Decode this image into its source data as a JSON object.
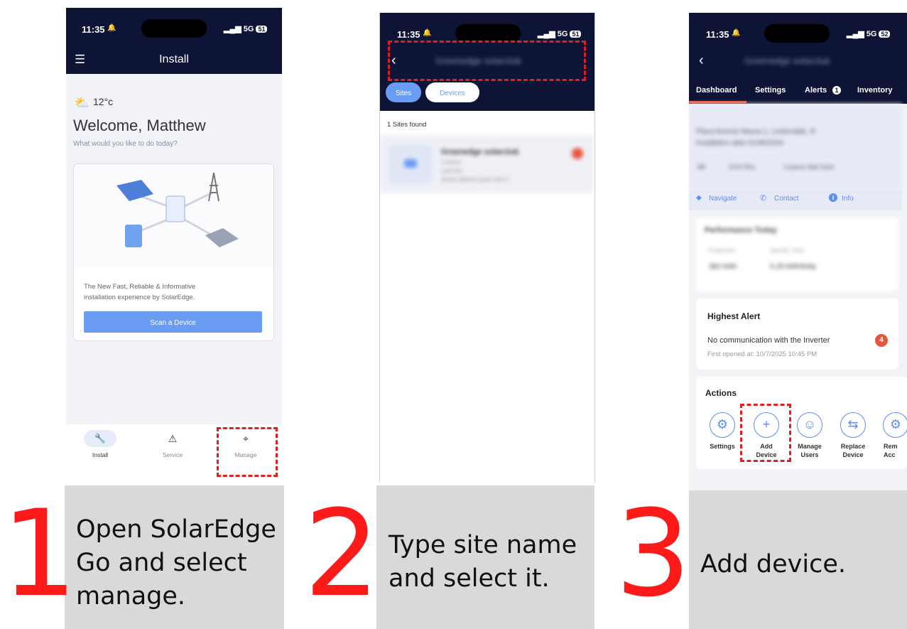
{
  "steps": [
    {
      "number": "1",
      "caption": "Open SolarEdge Go and select manage.",
      "caption_lines": [
        "Open SolarEdge",
        "Go and select",
        "manage."
      ],
      "screen": {
        "status": {
          "time": "11:35",
          "network": "5G",
          "battery": "51"
        },
        "header_title": "Install",
        "weather": "12°c",
        "welcome": "Welcome, Matthew",
        "subtitle": "What would you like to do today?",
        "card_text_line1": "The New Fast, Reliable & Informative",
        "card_text_line2": "installation experience by SolarEdge.",
        "scan_button": "Scan a Device",
        "bottom_nav": [
          {
            "label": "Install",
            "icon": "wrench-icon"
          },
          {
            "label": "Service",
            "icon": "warning-icon"
          },
          {
            "label": "Manage",
            "icon": "location-pin-icon"
          }
        ]
      }
    },
    {
      "number": "2",
      "caption": "Type site name and select it.",
      "caption_lines": [
        "Type site name",
        "and select it."
      ],
      "screen": {
        "status": {
          "time": "11:35",
          "network": "5G",
          "battery": "51"
        },
        "search_text": "Greenedge solarclub",
        "toggle": [
          "Sites",
          "Devices"
        ],
        "sites_found": "1 Sites found",
        "result_title": "Greenedge solarclub",
        "result_lines": [
          "1 Active",
          "Last site",
          "Street address goes here 1"
        ]
      }
    },
    {
      "number": "3",
      "caption": "Add device.",
      "caption_lines": [
        "Add device."
      ],
      "screen": {
        "status": {
          "time": "11:35",
          "network": "5G",
          "battery": "52"
        },
        "header_title": "Greenedge solarclub",
        "tabs": [
          "Dashboard",
          "Settings",
          "Alerts",
          "Inventory"
        ],
        "alerts_badge": "1",
        "site_address_line1": "Placa Antonio Maura 1, Lindendale, R",
        "site_address_line2": "Installation date 01/08/2024",
        "site_meta": [
          "8B",
          "CHV-Res",
          "Lisansz Mal Saint"
        ],
        "links": [
          "Navigate",
          "Contact",
          "Info"
        ],
        "performance_title": "Performance Today",
        "performance_labels": [
          "Production",
          "Specific Yield"
        ],
        "performance_values": [
          "382 kWh",
          "5.29 kWh/kWp"
        ],
        "highest_alert_title": "Highest Alert",
        "alert_text": "No communication with the Inverter",
        "alert_count": "4",
        "alert_opened": "First opened at: 10/7/2025 10:45 PM",
        "actions_title": "Actions",
        "actions": [
          {
            "label_1": "Settings",
            "label_2": "",
            "icon": "gear-icon"
          },
          {
            "label_1": "Add",
            "label_2": "Device",
            "icon": "plus-icon"
          },
          {
            "label_1": "Manage",
            "label_2": "Users",
            "icon": "users-icon"
          },
          {
            "label_1": "Replace",
            "label_2": "Device",
            "icon": "replace-icon"
          },
          {
            "label_1": "Rem",
            "label_2": "Acc",
            "icon": "gear-icon"
          }
        ]
      }
    }
  ],
  "colors": {
    "navy": "#0e1436",
    "accent": "#5d8ef0",
    "highlight": "#e02020",
    "step_number": "#ff1a1a"
  }
}
